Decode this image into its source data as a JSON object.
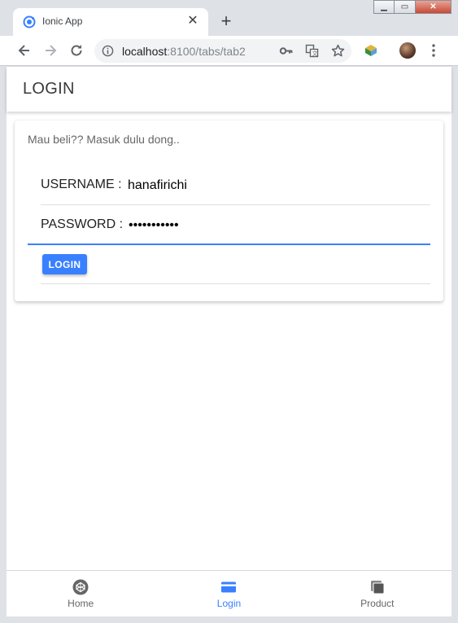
{
  "browser": {
    "tab_title": "Ionic App",
    "tab_close": "✕",
    "new_tab": "+",
    "url_host": "localhost",
    "url_path": ":8100/tabs/tab2",
    "window_controls": {
      "minimize": "▁",
      "maximize": "▭",
      "close": "✕"
    }
  },
  "app": {
    "header_title": "LOGIN",
    "card": {
      "subtitle": "Mau beli?? Masuk dulu dong..",
      "username_label": "USERNAME :",
      "username_value": "hanafirichi",
      "password_label": "PASSWORD :",
      "password_value": "hanafirichi",
      "login_button": "LOGIN"
    },
    "tabs": [
      {
        "label": "Home",
        "icon": "codepen-icon",
        "selected": false
      },
      {
        "label": "Login",
        "icon": "card-icon",
        "selected": true
      },
      {
        "label": "Product",
        "icon": "copy-icon",
        "selected": false
      }
    ]
  },
  "colors": {
    "primary": "#3880ff",
    "chrome": "#dee1e6",
    "text": "#222222"
  }
}
